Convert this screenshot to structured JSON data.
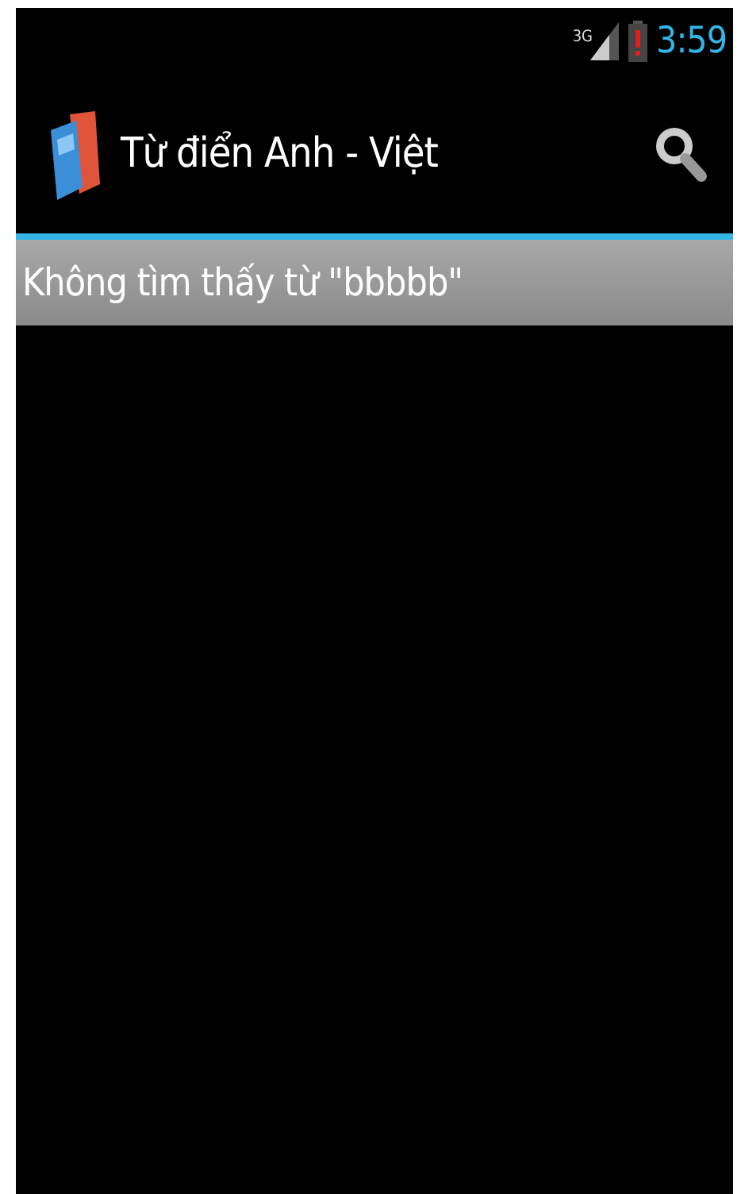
{
  "status_bar": {
    "network": "3G",
    "time": "3:59"
  },
  "action_bar": {
    "title": "Từ điển Anh - Việt"
  },
  "message": "Không tìm thấy từ \"bbbbb\""
}
